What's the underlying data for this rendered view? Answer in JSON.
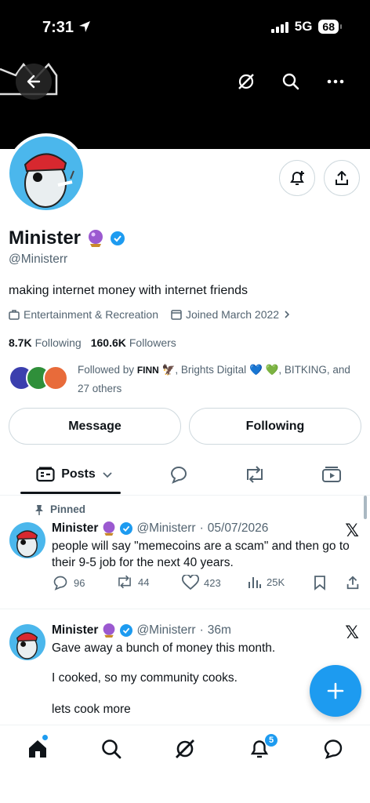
{
  "status_bar": {
    "time": "7:31",
    "network": "5G",
    "battery": "68"
  },
  "profile": {
    "name": "Minister",
    "handle": "@Ministerr",
    "bio": "making internet money with internet friends",
    "category": "Entertainment & Recreation",
    "joined": "Joined March 2022",
    "following_count": "8.7K",
    "following_label": "Following",
    "followers_count": "160.6K",
    "followers_label": "Followers",
    "followed_by_prefix": "Followed by",
    "followed_by_user1": "FINN",
    "followed_by_user2": ", Brights Digital",
    "followed_by_rest": ", BITKING, and",
    "followed_by_more": "27 others"
  },
  "buttons": {
    "message": "Message",
    "following": "Following"
  },
  "tabs": {
    "posts": "Posts"
  },
  "pinned_label": "Pinned",
  "posts": [
    {
      "name": "Minister",
      "handle": "@Ministerr",
      "sep": "·",
      "time": "05/07/2026",
      "text": "people will say \"memecoins are a scam\" and then go to their 9-5 job for the next 40 years.",
      "replies": "96",
      "reposts": "44",
      "likes": "423",
      "views": "25K"
    },
    {
      "name": "Minister",
      "handle": "@Ministerr",
      "sep": "·",
      "time": "36m",
      "line1": "Gave away a bunch of money this month.",
      "line2": "I cooked, so my community cooks.",
      "line3": "lets cook more"
    }
  ],
  "nav": {
    "notifications_badge": "5"
  },
  "colors": {
    "accent": "#1d9bf0",
    "text": "#0f1419",
    "muted": "#536471"
  }
}
